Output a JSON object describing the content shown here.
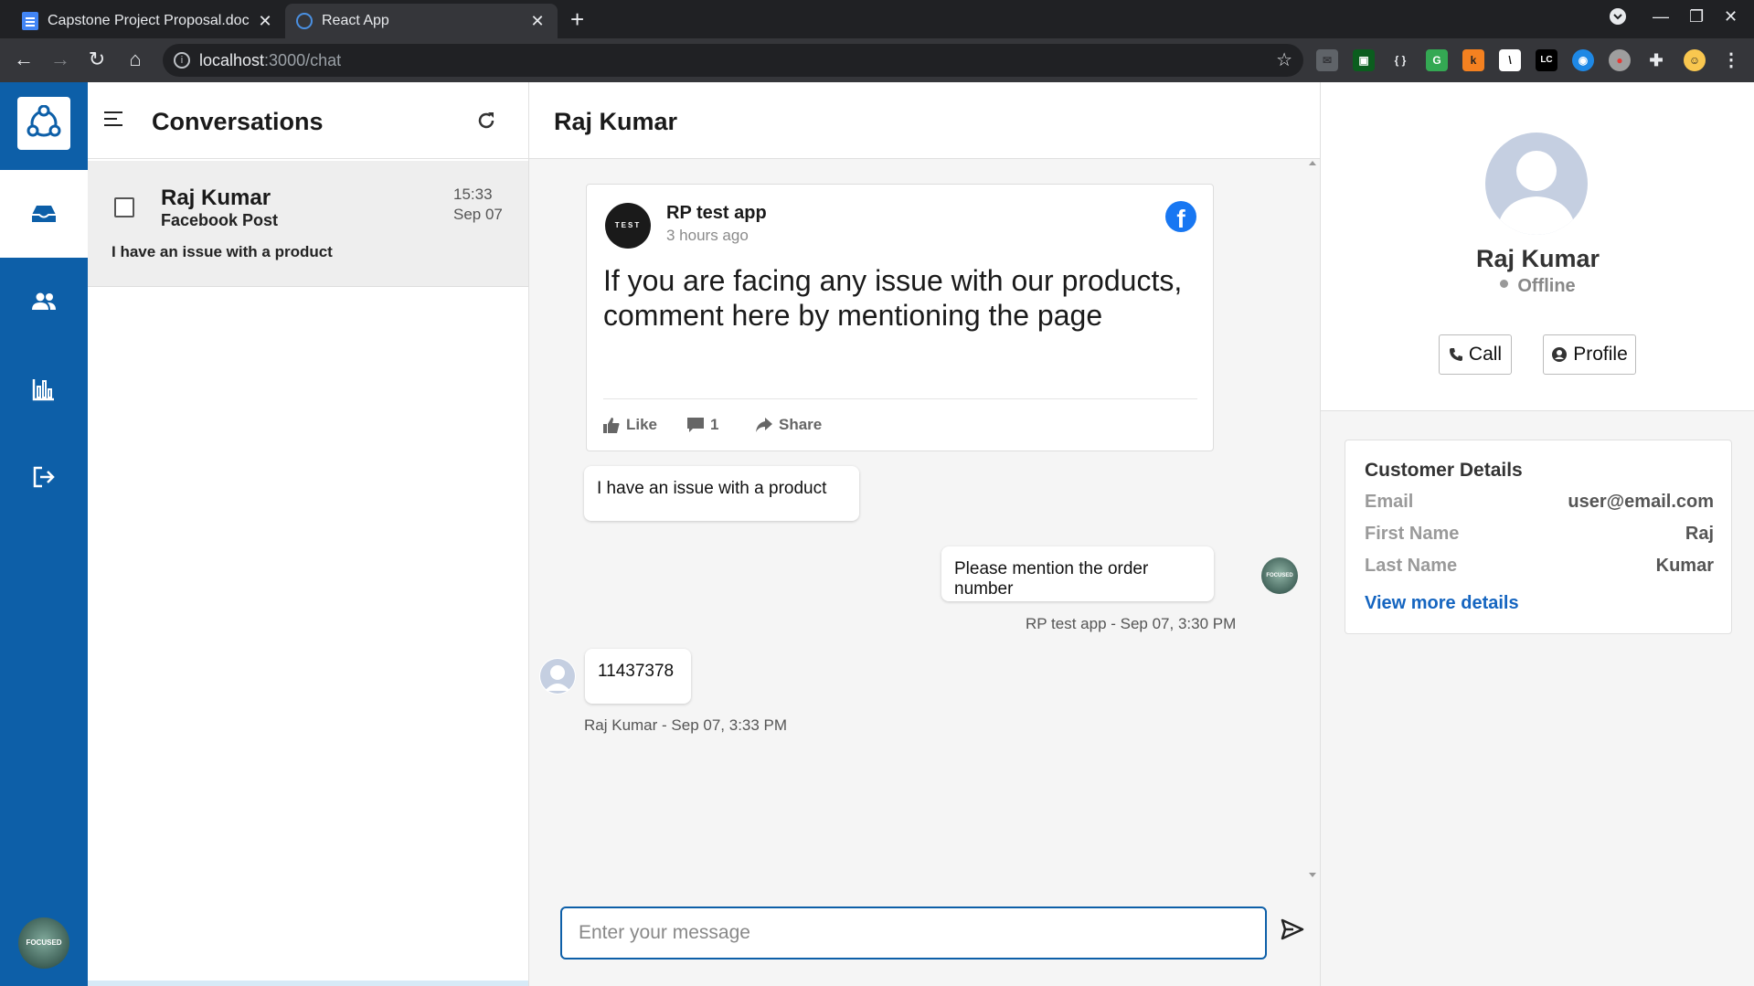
{
  "browser": {
    "tabs": [
      {
        "title": "Capstone Project Proposal.doc"
      },
      {
        "title": "React App"
      }
    ],
    "url_host": "localhost",
    "url_path": ":3000/chat"
  },
  "nav": {
    "items": [
      {
        "icon": "inbox-icon"
      },
      {
        "icon": "contacts-icon"
      },
      {
        "icon": "reports-icon"
      },
      {
        "icon": "logout-icon"
      }
    ],
    "avatar_text": "FOCUSED"
  },
  "conversations": {
    "title": "Conversations",
    "items": [
      {
        "name": "Raj Kumar",
        "source": "Facebook Post",
        "time": "15:33",
        "date": "Sep 07",
        "preview": "I have an issue with a product"
      }
    ]
  },
  "chat": {
    "title": "Raj Kumar",
    "post": {
      "avatar_text": "TEST",
      "author": "RP test app",
      "time_ago": "3 hours ago",
      "body": "If you are facing any issue with our products, comment here by mentioning the page",
      "like_label": "Like",
      "comment_count": "1",
      "share_label": "Share"
    },
    "messages": [
      {
        "text": "I have an issue with a product",
        "direction": "incoming"
      },
      {
        "text": "Please mention the order number",
        "direction": "outgoing",
        "meta": "RP test app - Sep 07, 3:30 PM"
      },
      {
        "text": "11437378",
        "direction": "incoming",
        "meta": "Raj Kumar - Sep 07, 3:33 PM"
      }
    ],
    "composer_placeholder": "Enter your message"
  },
  "profile": {
    "name": "Raj Kumar",
    "status": "Offline",
    "call_label": "Call",
    "profile_label": "Profile",
    "details": {
      "title": "Customer Details",
      "rows": [
        {
          "label": "Email",
          "value": "user@email.com"
        },
        {
          "label": "First Name",
          "value": "Raj"
        },
        {
          "label": "Last Name",
          "value": "Kumar"
        }
      ],
      "view_more": "View more details"
    }
  },
  "colors": {
    "brand": "#0d5fa8",
    "facebook": "#1877f2",
    "link": "#1565c0"
  }
}
